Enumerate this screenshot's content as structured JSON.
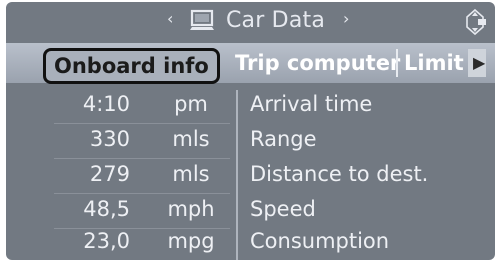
{
  "header": {
    "title": "Car Data",
    "left_arrow": "‹",
    "right_arrow": "›",
    "app_icon": "computer-icon",
    "controller_icon": "controller-icon"
  },
  "tabs": [
    {
      "label": "Onboard info",
      "active": true
    },
    {
      "label": "Trip computer",
      "active": false
    },
    {
      "label": "Limit",
      "active": false
    }
  ],
  "tab_scroll": "▶",
  "rows": [
    {
      "value": "4:10",
      "unit": "pm",
      "label": "Arrival time"
    },
    {
      "value": "330",
      "unit": "mls",
      "label": "Range"
    },
    {
      "value": "279",
      "unit": "mls",
      "label": "Distance to dest."
    },
    {
      "value": "48,5",
      "unit": "mph",
      "label": "Speed"
    },
    {
      "value": "23,0",
      "unit": "mpg",
      "label": "Consumption"
    }
  ],
  "colors": {
    "screen": "#727982",
    "tabbar": "#a9b0bb",
    "text": "#eef0f4"
  }
}
